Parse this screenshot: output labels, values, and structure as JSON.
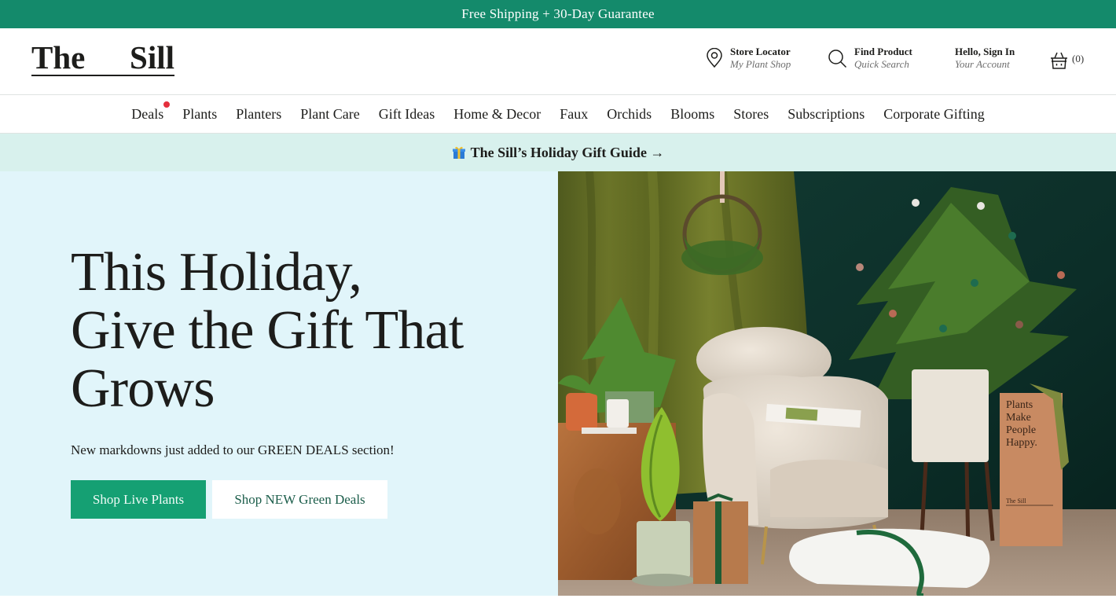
{
  "promo_bar": {
    "text": "Free Shipping + 30-Day Guarantee"
  },
  "header": {
    "logo": {
      "left": "The",
      "right": "Sill"
    },
    "store_locator": {
      "title": "Store Locator",
      "subtitle": "My Plant Shop",
      "icon": "map-pin-icon"
    },
    "find_product": {
      "title": "Find Product",
      "subtitle": "Quick Search",
      "icon": "search-icon"
    },
    "account": {
      "title": "Hello, Sign In",
      "subtitle": "Your Account"
    },
    "cart": {
      "icon": "basket-icon",
      "count": "(0)"
    }
  },
  "nav": {
    "items": [
      {
        "label": "Deals",
        "badge": true
      },
      {
        "label": "Plants"
      },
      {
        "label": "Planters"
      },
      {
        "label": "Plant Care"
      },
      {
        "label": "Gift Ideas"
      },
      {
        "label": "Home & Decor"
      },
      {
        "label": "Faux"
      },
      {
        "label": "Orchids"
      },
      {
        "label": "Blooms"
      },
      {
        "label": "Stores"
      },
      {
        "label": "Subscriptions"
      },
      {
        "label": "Corporate Gifting"
      }
    ]
  },
  "guide_bar": {
    "icon": "gift-icon",
    "text": "The Sill’s Holiday Gift Guide →"
  },
  "hero": {
    "title_lines": [
      "This Holiday,",
      "Give the Gift That",
      "Grows"
    ],
    "subtitle": "New markdowns just added to our GREEN DEALS section!",
    "primary_button": "Shop Live Plants",
    "secondary_button": "Shop NEW Green Deals",
    "image": {
      "alt": "Holiday living room with Norfolk pine tree, boucle armchair, wreath and gift boxes",
      "box_text": [
        "Plants",
        "Make",
        "People",
        "Happy."
      ],
      "box_brand": "The Sill"
    }
  },
  "colors": {
    "brand_green": "#148a6b",
    "button_green": "#15a073",
    "guide_bg": "#d8f1ed",
    "hero_bg": "#e1f5fa",
    "badge_red": "#e52f3c"
  }
}
